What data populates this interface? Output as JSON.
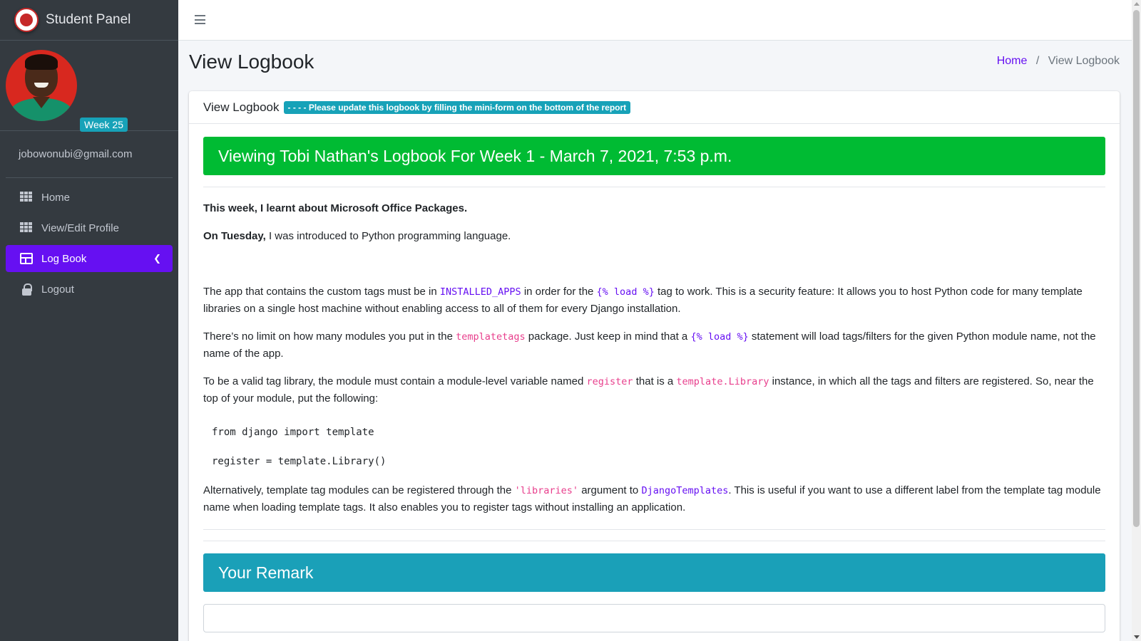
{
  "brand": {
    "title": "Student Panel",
    "logo_icon": "school-seal-icon"
  },
  "user": {
    "week_badge": "Week 25",
    "email": "jobowonubi@gmail.com"
  },
  "sidebar": {
    "items": [
      {
        "label": "Home",
        "icon": "grid-icon"
      },
      {
        "label": "View/Edit Profile",
        "icon": "grid-icon"
      },
      {
        "label": "Log Book",
        "icon": "table-icon",
        "active": true
      },
      {
        "label": "Logout",
        "icon": "lock-icon"
      }
    ]
  },
  "header": {
    "menu_icon": "hamburger-icon"
  },
  "page": {
    "title": "View Logbook",
    "breadcrumb": {
      "home": "Home",
      "separator": "/",
      "current": "View Logbook"
    }
  },
  "card": {
    "title": "View Logbook",
    "notice": "- - - - Please update this logbook by filling the mini-form on the bottom of the report",
    "banner": "Viewing Tobi Nathan's Logbook For Week 1 - March 7, 2021, 7:53 p.m.",
    "report": {
      "p1": "This week, I learnt about Microsoft Office Packages.",
      "p2_bold": "On Tuesday,",
      "p2_rest": " I was introduced to Python programming language.",
      "p3_a": "The app that contains the custom tags must be in ",
      "p3_code1": "INSTALLED_APPS",
      "p3_b": " in order for the ",
      "p3_code2": "{% load %}",
      "p3_c": " tag to work. This is a security feature: It allows you to host Python code for many template libraries on a single host machine without enabling access to all of them for every Django installation.",
      "p4_a": "There’s no limit on how many modules you put in the ",
      "p4_code1": "templatetags",
      "p4_b": " package. Just keep in mind that a ",
      "p4_code2": "{% load %}",
      "p4_c": " statement will load tags/filters for the given Python module name, not the name of the app.",
      "p5_a": "To be a valid tag library, the module must contain a module-level variable named ",
      "p5_code1": "register",
      "p5_b": " that is a ",
      "p5_code2": "template.Library",
      "p5_c": " instance, in which all the tags and filters are registered. So, near the top of your module, put the following:",
      "code_line1": "from django import template",
      "code_line2": "register = template.Library()",
      "p6_a": "Alternatively, template tag modules can be registered through the ",
      "p6_code1": "'libraries'",
      "p6_b": " argument to ",
      "p6_code2": "DjangoTemplates",
      "p6_c": ". This is useful if you want to use a different label from the template tag module name when loading template tags. It also enables you to register tags without installing an application."
    },
    "remark_title": "Your Remark"
  },
  "colors": {
    "sidebar_bg": "#343a40",
    "active_nav": "#6610f2",
    "banner_green": "#00bb33",
    "remark_teal": "#1aa0b8",
    "badge_info": "#17a2b8"
  }
}
